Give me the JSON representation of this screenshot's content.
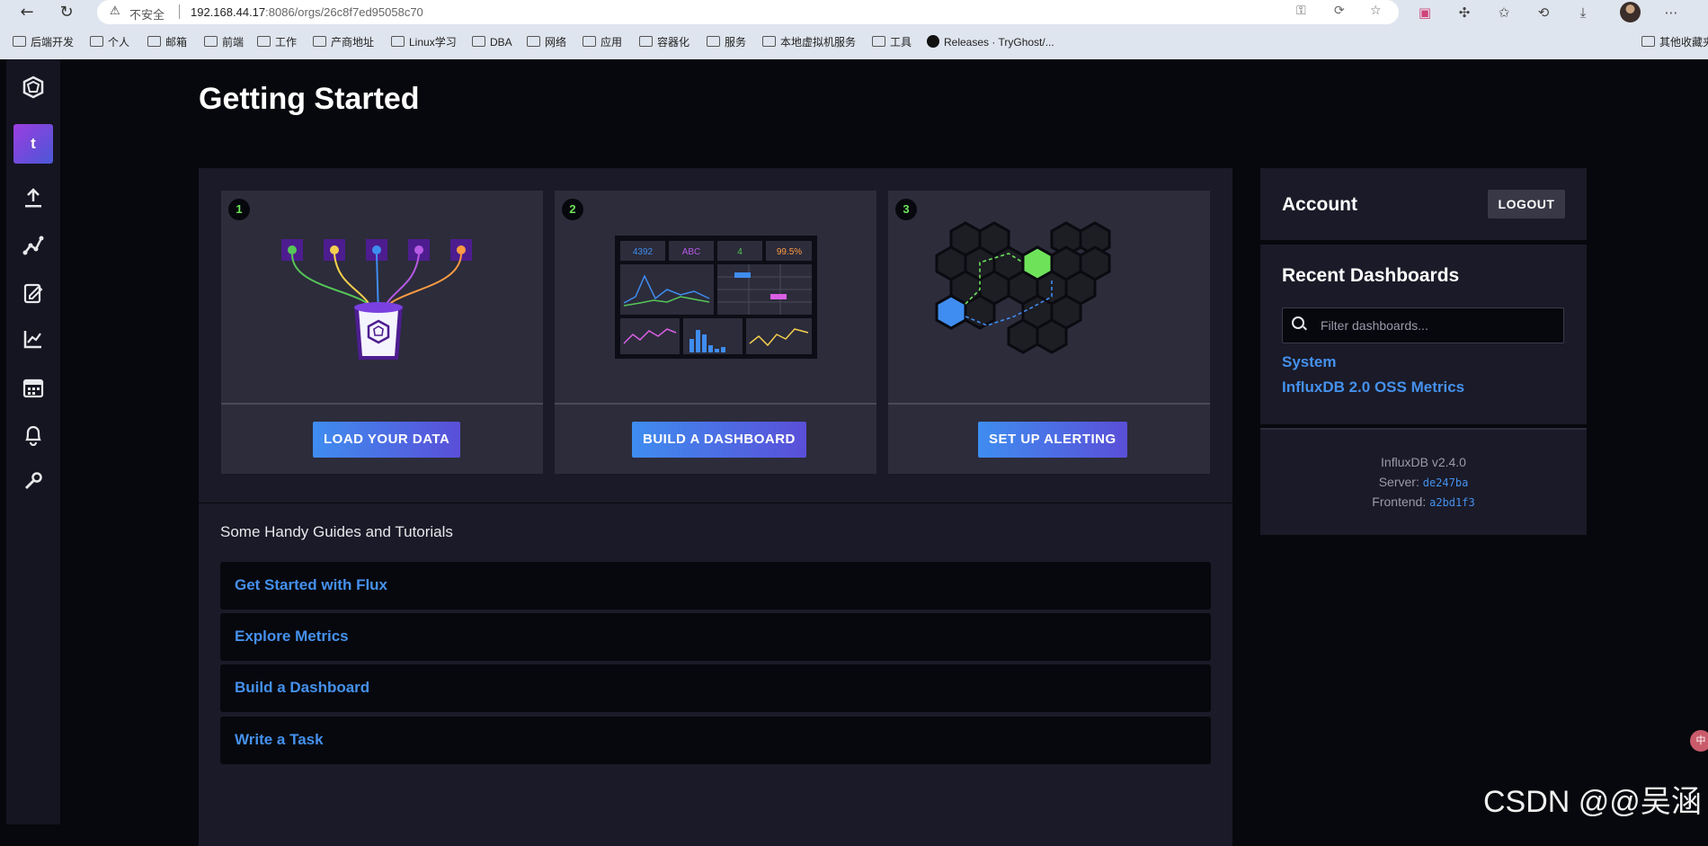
{
  "browser": {
    "url_warning": "不安全",
    "url_host": "192.168.44.17",
    "url_rest": ":8086/orgs/26c8f7ed95058c70",
    "bookmarks": [
      "后端开发",
      "个人",
      "邮箱",
      "前端",
      "工作",
      "产商地址",
      "Linux学习",
      "DBA",
      "网络",
      "应用",
      "容器化",
      "服务",
      "本地虚拟机服务",
      "工具",
      "Releases · TryGhost/...",
      "其他收藏夹"
    ]
  },
  "sidebar": {
    "org_initial": "t"
  },
  "page": {
    "title": "Getting Started"
  },
  "steps": [
    {
      "number": "1",
      "button": "LOAD YOUR DATA"
    },
    {
      "number": "2",
      "button": "BUILD A DASHBOARD"
    },
    {
      "number": "3",
      "button": "SET UP ALERTING"
    }
  ],
  "dashboard_illustration": {
    "stats": [
      "4392",
      "ABC",
      "4",
      "99.5%"
    ]
  },
  "guides": {
    "title": "Some Handy Guides and Tutorials",
    "items": [
      "Get Started with Flux",
      "Explore Metrics",
      "Build a Dashboard",
      "Write a Task"
    ]
  },
  "account": {
    "title": "Account",
    "logout": "LOGOUT"
  },
  "recent_dashboards": {
    "title": "Recent Dashboards",
    "filter_placeholder": "Filter dashboards...",
    "items": [
      "System",
      "InfluxDB 2.0 OSS Metrics"
    ]
  },
  "version": {
    "product": "InfluxDB v2.4.0",
    "server_label": "Server:",
    "server": "de247ba",
    "frontend_label": "Frontend:",
    "frontend": "a2bd1f3"
  },
  "watermark": "CSDN @@吴涵",
  "colors": {
    "background": "#07080d",
    "panel": "#1a1a28",
    "card": "#2c2c3b",
    "link": "#4591ed",
    "button_gradient_start": "#3f8df0",
    "button_gradient_end": "#5a4fd8",
    "step_number": "#6ee35a"
  }
}
